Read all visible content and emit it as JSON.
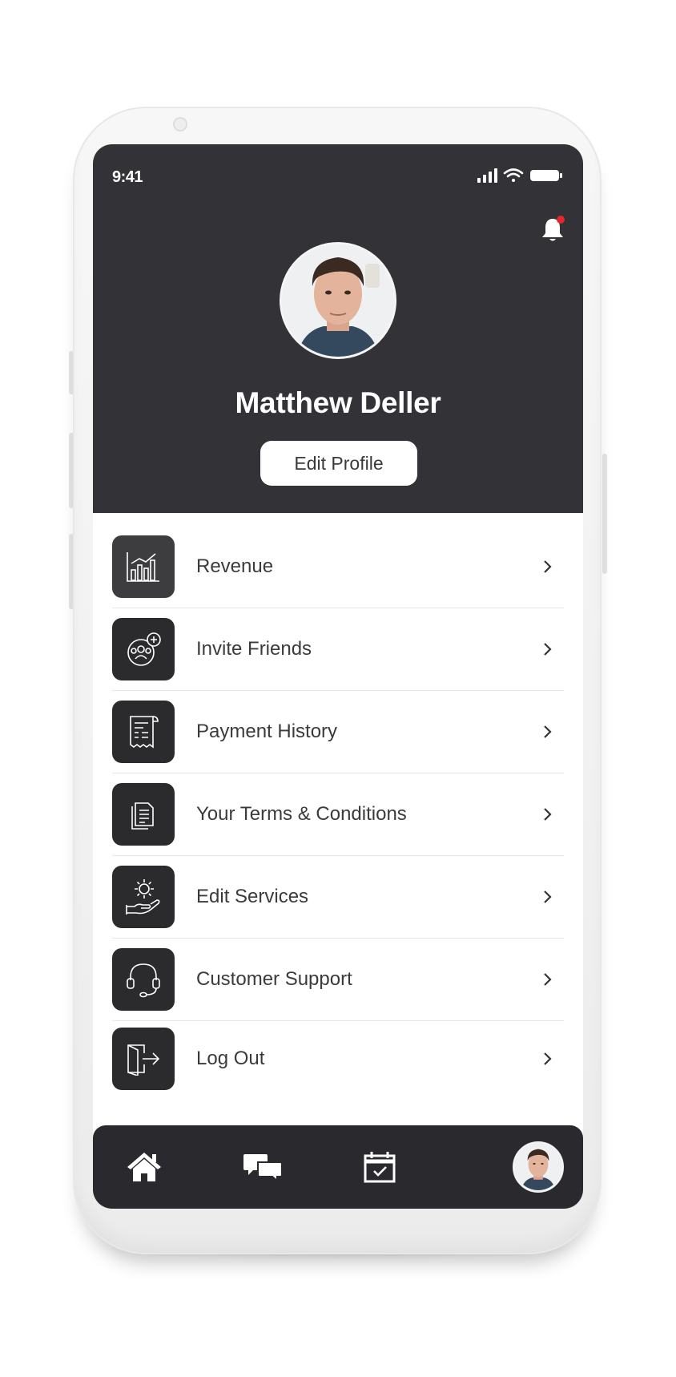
{
  "status_bar": {
    "time": "9:41"
  },
  "profile": {
    "name": "Matthew Deller",
    "edit_button": "Edit Profile"
  },
  "menu": {
    "items": [
      {
        "label": "Revenue",
        "icon": "chart-icon"
      },
      {
        "label": "Invite Friends",
        "icon": "invite-friends-icon"
      },
      {
        "label": "Payment History",
        "icon": "receipt-icon"
      },
      {
        "label": "Your Terms & Conditions",
        "icon": "document-icon"
      },
      {
        "label": "Edit Services",
        "icon": "gear-hand-icon"
      },
      {
        "label": "Customer Support",
        "icon": "headset-icon"
      },
      {
        "label": "Log Out",
        "icon": "logout-icon"
      }
    ]
  },
  "tabbar": {
    "items": [
      {
        "icon": "home-icon"
      },
      {
        "icon": "chat-icon"
      },
      {
        "icon": "calendar-check-icon"
      },
      {
        "icon": "profile-avatar"
      }
    ]
  },
  "colors": {
    "header_bg": "#333236",
    "icon_tile_bg": "#2b2b2d",
    "tabbar_bg": "#2a292d",
    "notification_dot": "#e5262c"
  }
}
